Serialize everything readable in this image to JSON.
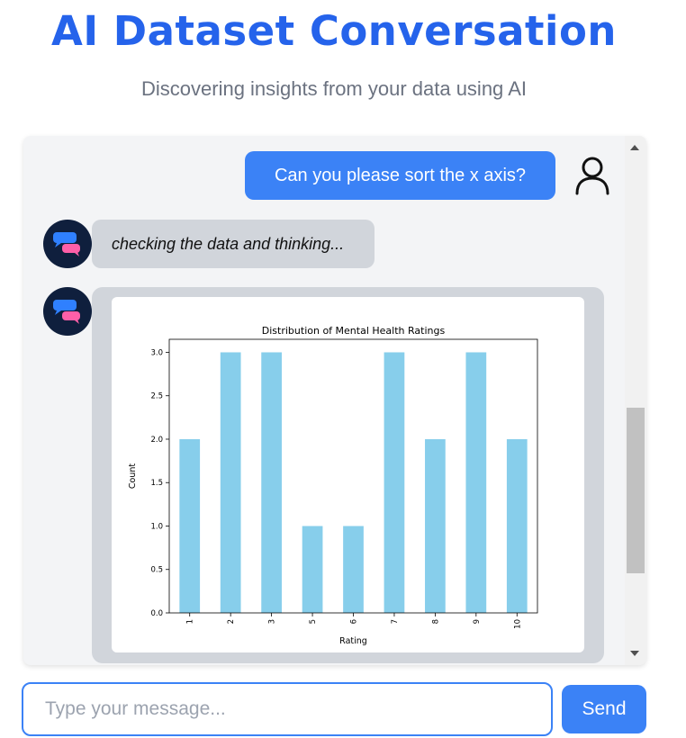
{
  "header": {
    "title": "AI Dataset Conversation",
    "subtitle": "Discovering insights from your data using AI"
  },
  "chat": {
    "user_message": "Can you please sort the x axis?",
    "bot_thinking": "checking the data and thinking...",
    "user_icon": "user-icon",
    "bot_icon": "chat-bubbles-icon"
  },
  "input": {
    "placeholder": "Type your message...",
    "value": ""
  },
  "send_label": "Send",
  "colors": {
    "accent": "#3b82f6",
    "title": "#2563eb",
    "bar": "#87ceeb",
    "bot_avatar": "#0f1f3d"
  },
  "chart_data": {
    "type": "bar",
    "title": "Distribution of Mental Health Ratings",
    "xlabel": "Rating",
    "ylabel": "Count",
    "categories": [
      "1",
      "2",
      "3",
      "5",
      "6",
      "7",
      "8",
      "9",
      "10"
    ],
    "values": [
      2,
      3,
      3,
      1,
      1,
      3,
      2,
      3,
      2
    ],
    "ylim": [
      0,
      3.15
    ],
    "yticks": [
      "0.0",
      "0.5",
      "1.0",
      "1.5",
      "2.0",
      "2.5",
      "3.0"
    ],
    "grid": false,
    "legend": "none"
  }
}
